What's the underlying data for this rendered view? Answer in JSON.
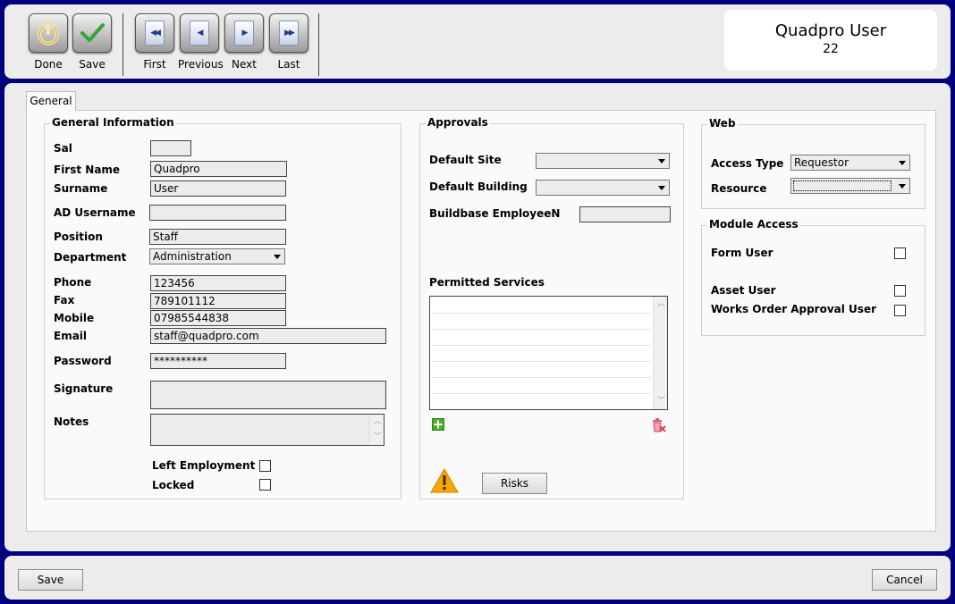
{
  "toolbar": {
    "done_label": "Done",
    "save_label": "Save",
    "first_label": "First",
    "previous_label": "Previous",
    "next_label": "Next",
    "last_label": "Last"
  },
  "user_header": {
    "name": "Quadpro User",
    "id": "22"
  },
  "tabs": [
    {
      "label": "General",
      "active": true
    }
  ],
  "general_info": {
    "title": "General Information",
    "sal_label": "Sal",
    "sal_value": "",
    "first_name_label": "First Name",
    "first_name_value": "Quadpro",
    "surname_label": "Surname",
    "surname_value": "User",
    "ad_username_label": "AD Username",
    "ad_username_value": "",
    "position_label": "Position",
    "position_value": "Staff",
    "department_label": "Department",
    "department_value": "Administration",
    "phone_label": "Phone",
    "phone_value": "123456",
    "fax_label": "Fax",
    "fax_value": "789101112",
    "mobile_label": "Mobile",
    "mobile_value": "07985544838",
    "email_label": "Email",
    "email_value": "staff@quadpro.com",
    "password_label": "Password",
    "password_value": "**********",
    "signature_label": "Signature",
    "notes_label": "Notes",
    "notes_value": "",
    "left_employment_label": "Left Employment",
    "left_employment_checked": false,
    "locked_label": "Locked",
    "locked_checked": false
  },
  "approvals": {
    "title": "Approvals",
    "default_site_label": "Default Site",
    "default_site_value": "",
    "default_building_label": "Default Building",
    "default_building_value": "",
    "buildbase_label": "Buildbase EmployeeN",
    "buildbase_value": "",
    "permitted_services_label": "Permitted Services",
    "permitted_services": [],
    "risks_label": "Risks"
  },
  "web": {
    "title": "Web",
    "access_type_label": "Access Type",
    "access_type_value": "Requestor",
    "resource_label": "Resource",
    "resource_value": ""
  },
  "module_access": {
    "title": "Module Access",
    "form_user_label": "Form User",
    "form_user_checked": false,
    "asset_user_label": "Asset User",
    "asset_user_checked": false,
    "works_order_label": "Works Order Approval User",
    "works_order_checked": false
  },
  "footer": {
    "save_label": "Save",
    "cancel_label": "Cancel"
  },
  "colors": {
    "window_frame": "#00007f",
    "panel": "#ececec",
    "tab_page": "#fafafa",
    "add_icon": "#4caf2a",
    "delete_icon": "#d9405a",
    "warning_icon": "#f5a800"
  }
}
